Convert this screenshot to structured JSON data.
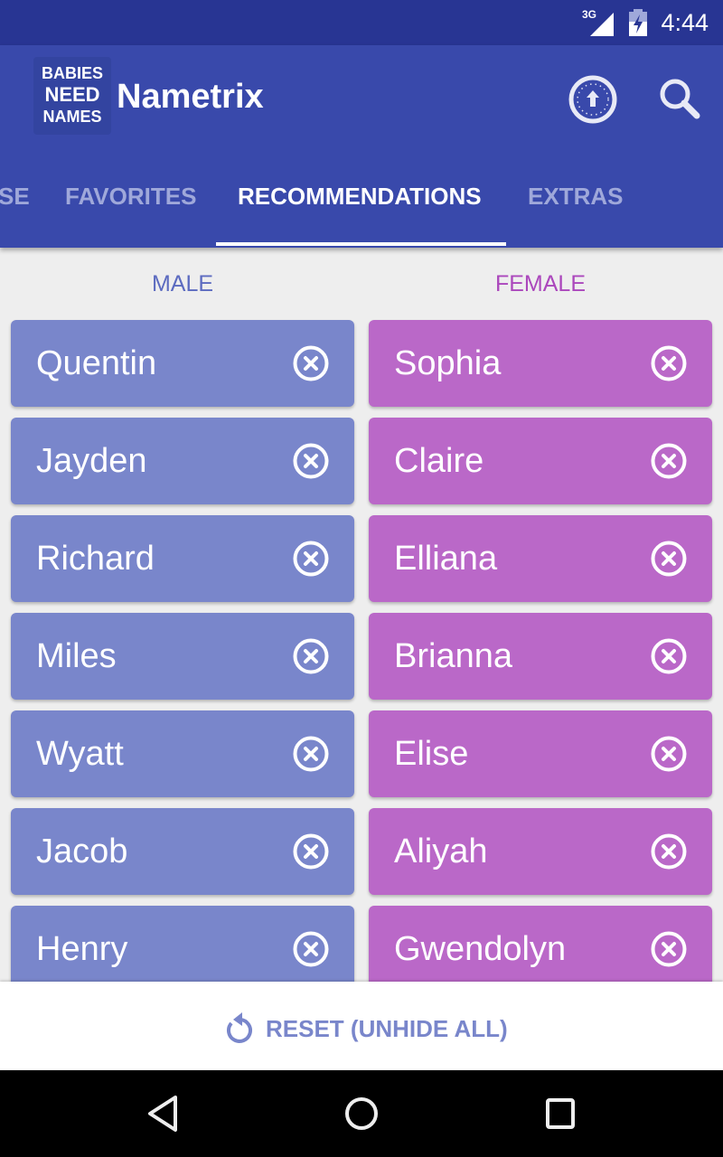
{
  "status_bar": {
    "network": "3G",
    "time": "4:44"
  },
  "app_bar": {
    "logo": {
      "line1": "BABIES",
      "line2": "NEED",
      "line3": "NAMES"
    },
    "title": "Nametrix",
    "icons": [
      "upload-circle-icon",
      "search-icon"
    ]
  },
  "tabs": [
    {
      "label": "SE",
      "active": false
    },
    {
      "label": "FAVORITES",
      "active": false
    },
    {
      "label": "RECOMMENDATIONS",
      "active": true
    },
    {
      "label": "EXTRAS",
      "active": false
    }
  ],
  "columns": {
    "male": "MALE",
    "female": "FEMALE"
  },
  "male_names": [
    "Quentin",
    "Jayden",
    "Richard",
    "Miles",
    "Wyatt",
    "Jacob",
    "Henry"
  ],
  "female_names": [
    "Sophia",
    "Claire",
    "Elliana",
    "Brianna",
    "Elise",
    "Aliyah",
    "Gwendolyn"
  ],
  "colors": {
    "status_bar": "#283593",
    "app_bar": "#3949ab",
    "male": "#7986cb",
    "female": "#ba68c8",
    "male_label": "#5c6bc0",
    "female_label": "#ab47bc"
  },
  "reset": {
    "label": "RESET (UNHIDE ALL)",
    "icon": "undo-icon"
  }
}
